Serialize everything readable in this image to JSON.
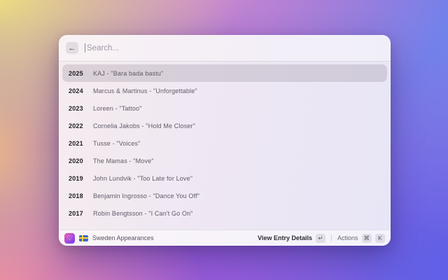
{
  "search": {
    "placeholder": "Search...",
    "back_icon": "←"
  },
  "entries": [
    {
      "year": "2025",
      "title": "KAJ - \"Bara bada bastu\"",
      "selected": true
    },
    {
      "year": "2024",
      "title": "Marcus & Martinus - \"Unforgettable\"",
      "selected": false
    },
    {
      "year": "2023",
      "title": "Loreen - \"Tattoo\"",
      "selected": false
    },
    {
      "year": "2022",
      "title": "Cornelia Jakobs - \"Hold Me Closer\"",
      "selected": false
    },
    {
      "year": "2021",
      "title": "Tusse - \"Voices\"",
      "selected": false
    },
    {
      "year": "2020",
      "title": "The Mamas - \"Move\"",
      "selected": false
    },
    {
      "year": "2019",
      "title": "John Lundvik - \"Too Late for Love\"",
      "selected": false
    },
    {
      "year": "2018",
      "title": "Benjamin Ingrosso - \"Dance You Off\"",
      "selected": false
    },
    {
      "year": "2017",
      "title": "Robin Bengtsson - \"I Can't Go On\"",
      "selected": false
    }
  ],
  "footer": {
    "app_icon_glyph": "♡",
    "source_label": "Sweden Appearances",
    "primary_action": "View Entry Details",
    "primary_key": "↵",
    "secondary_action": "Actions",
    "secondary_keys": [
      "⌘",
      "K"
    ]
  },
  "colors": {
    "selection": "rgba(99,90,104,0.18)",
    "accent_icon_gradient_start": "#ef5fa2",
    "accent_icon_gradient_end": "#6d3fe6",
    "flag_blue": "#3c6ac8",
    "flag_yellow": "#f6cf3e"
  }
}
